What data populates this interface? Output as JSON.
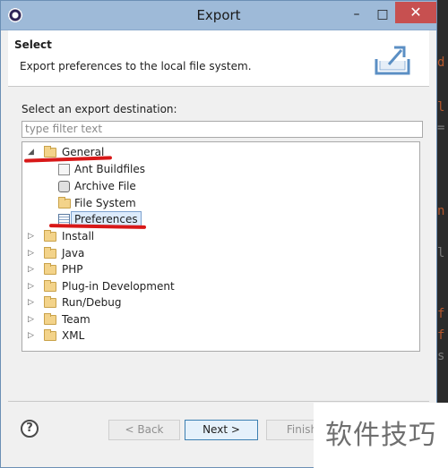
{
  "window": {
    "title": "Export"
  },
  "header": {
    "title": "Select",
    "description": "Export preferences to the local file system."
  },
  "destination": {
    "label": "Select an export destination:",
    "filter_placeholder": "type filter text"
  },
  "tree": {
    "items": [
      {
        "label": "General",
        "expanded": true,
        "icon": "folder-icon"
      },
      {
        "label": "Ant Buildfiles",
        "icon": "ant-icon"
      },
      {
        "label": "Archive File",
        "icon": "archive-icon"
      },
      {
        "label": "File System",
        "icon": "folder-icon"
      },
      {
        "label": "Preferences",
        "icon": "preferences-icon",
        "selected": true
      },
      {
        "label": "Install",
        "expanded": false,
        "icon": "folder-icon"
      },
      {
        "label": "Java",
        "expanded": false,
        "icon": "folder-icon"
      },
      {
        "label": "PHP",
        "expanded": false,
        "icon": "folder-icon"
      },
      {
        "label": "Plug-in Development",
        "expanded": false,
        "icon": "folder-icon"
      },
      {
        "label": "Run/Debug",
        "expanded": false,
        "icon": "folder-icon"
      },
      {
        "label": "Team",
        "expanded": false,
        "icon": "folder-icon"
      },
      {
        "label": "XML",
        "expanded": false,
        "icon": "folder-icon"
      }
    ]
  },
  "buttons": {
    "help": "?",
    "back": "< Back",
    "next": "Next >",
    "finish": "Finish"
  },
  "watermark": "软件技巧",
  "colors": {
    "titlebar": "#9ebad8",
    "close_button": "#c75050",
    "annotation_red": "#d81818",
    "selection": "#dcebfc"
  }
}
